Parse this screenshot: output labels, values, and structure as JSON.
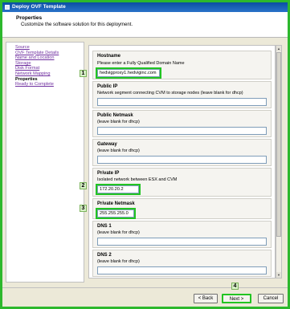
{
  "window": {
    "title": "Deploy OVF Template"
  },
  "header": {
    "title": "Properties",
    "subtitle": "Customize the software solution for this deployment."
  },
  "nav": {
    "items": [
      {
        "label": "Source",
        "active": false
      },
      {
        "label": "OVF Template Details",
        "active": false
      },
      {
        "label": "Name and Location",
        "active": false
      },
      {
        "label": "Storage",
        "active": false
      },
      {
        "label": "Disk Format",
        "active": false
      },
      {
        "label": "Network Mapping",
        "active": false
      },
      {
        "label": "Properties",
        "active": true
      },
      {
        "label": "Ready to Complete",
        "active": false
      }
    ]
  },
  "form": {
    "hostname": {
      "label": "Hostname",
      "description": "Please enter a Fully Qualified Domain Name",
      "value": "hedvigproxy1.hedviginc.com"
    },
    "public_ip": {
      "label": "Public IP",
      "description": "Network segment connecting CVM to storage nodes (leave blank for dhcp)",
      "value": ""
    },
    "public_netmask": {
      "label": "Public Netmask",
      "description": "(leave blank for dhcp)",
      "value": ""
    },
    "gateway": {
      "label": "Gateway",
      "description": "(leave blank for dhcp)",
      "value": ""
    },
    "private_ip": {
      "label": "Private IP",
      "description": "Isolated network between ESX and CVM",
      "value": "172.20.20.2"
    },
    "private_netmask": {
      "label": "Private Netmask",
      "description": "",
      "value": "255.255.255.0"
    },
    "dns1": {
      "label": "DNS 1",
      "description": "(leave blank for dhcp)",
      "value": ""
    },
    "dns2": {
      "label": "DNS 2",
      "description": "(leave blank for dhcp)",
      "value": ""
    }
  },
  "annotations": {
    "one": "1",
    "two": "2",
    "three": "3",
    "four": "4"
  },
  "footer": {
    "back_label": "< Back",
    "next_label": "Next >",
    "cancel_label": "Cancel"
  },
  "colors": {
    "highlight": "#22c422",
    "titlebar": "#0a4fa3"
  }
}
